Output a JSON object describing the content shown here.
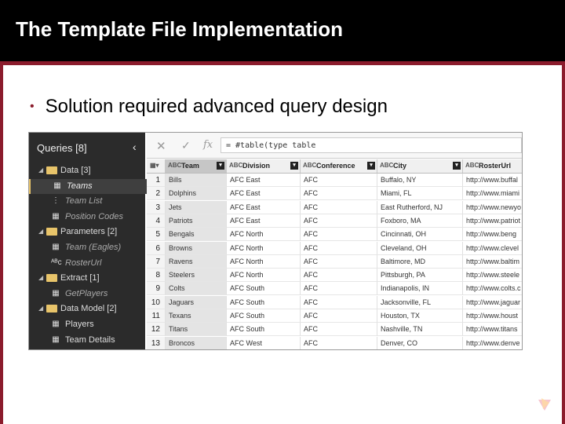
{
  "slide": {
    "title": "The Template File Implementation",
    "bullet_marker": "•",
    "bullet": "Solution required advanced query design"
  },
  "queries": {
    "header": "Queries [8]",
    "collapse_icon": "chevron-left-icon",
    "items": [
      {
        "label": "Data [3]",
        "type": "folder",
        "indent": 0
      },
      {
        "label": "Teams",
        "type": "table",
        "indent": 1,
        "selected": true,
        "italic": true
      },
      {
        "label": "Team List",
        "type": "list",
        "indent": 1,
        "italic": true
      },
      {
        "label": "Position Codes",
        "type": "table",
        "indent": 1,
        "italic": true
      },
      {
        "label": "Parameters [2]",
        "type": "folder",
        "indent": 0
      },
      {
        "label": "Team (Eagles)",
        "type": "table",
        "indent": 1,
        "italic": true
      },
      {
        "label": "RosterUrl",
        "type": "text",
        "indent": 1,
        "italic": true
      },
      {
        "label": "Extract [1]",
        "type": "folder",
        "indent": 0
      },
      {
        "label": "GetPlayers",
        "type": "table",
        "indent": 1,
        "italic": true
      },
      {
        "label": "Data Model [2]",
        "type": "folder",
        "indent": 0
      },
      {
        "label": "Players",
        "type": "table",
        "indent": 1,
        "italic": false
      },
      {
        "label": "Team Details",
        "type": "table",
        "indent": 1,
        "italic": false
      }
    ]
  },
  "formula_bar": {
    "cancel": "✕",
    "commit": "✓",
    "fx": "fx",
    "text": "= #table(type table"
  },
  "grid": {
    "columns": [
      {
        "type": "ABC",
        "label": "Team"
      },
      {
        "type": "ABC",
        "label": "Division"
      },
      {
        "type": "ABC",
        "label": "Conference"
      },
      {
        "type": "ABC",
        "label": "City"
      },
      {
        "type": "ABC",
        "label": "RosterUrl"
      }
    ],
    "rows": [
      [
        "1",
        "Bills",
        "AFC East",
        "AFC",
        "Buffalo, NY",
        "http://www.buffal"
      ],
      [
        "2",
        "Dolphins",
        "AFC East",
        "AFC",
        "Miami, FL",
        "http://www.miami"
      ],
      [
        "3",
        "Jets",
        "AFC East",
        "AFC",
        "East Rutherford, NJ",
        "http://www.newyo"
      ],
      [
        "4",
        "Patriots",
        "AFC East",
        "AFC",
        "Foxboro, MA",
        "http://www.patriot"
      ],
      [
        "5",
        "Bengals",
        "AFC North",
        "AFC",
        "Cincinnati, OH",
        "http://www.beng"
      ],
      [
        "6",
        "Browns",
        "AFC North",
        "AFC",
        "Cleveland, OH",
        "http://www.clevel"
      ],
      [
        "7",
        "Ravens",
        "AFC North",
        "AFC",
        "Baltimore, MD",
        "http://www.baltim"
      ],
      [
        "8",
        "Steelers",
        "AFC North",
        "AFC",
        "Pittsburgh, PA",
        "http://www.steele"
      ],
      [
        "9",
        "Colts",
        "AFC South",
        "AFC",
        "Indianapolis, IN",
        "http://www.colts.c"
      ],
      [
        "10",
        "Jaguars",
        "AFC South",
        "AFC",
        "Jacksonville, FL",
        "http://www.jaguar"
      ],
      [
        "11",
        "Texans",
        "AFC South",
        "AFC",
        "Houston, TX",
        "http://www.houst"
      ],
      [
        "12",
        "Titans",
        "AFC South",
        "AFC",
        "Nashville, TN",
        "http://www.titans"
      ],
      [
        "13",
        "Broncos",
        "AFC West",
        "AFC",
        "Denver, CO",
        "http://www.denve"
      ]
    ]
  },
  "colors": {
    "accent": "#8b1c2c",
    "title_bar": "#000000",
    "pane_dark": "#2b2b2b",
    "folder": "#e8c46a"
  }
}
